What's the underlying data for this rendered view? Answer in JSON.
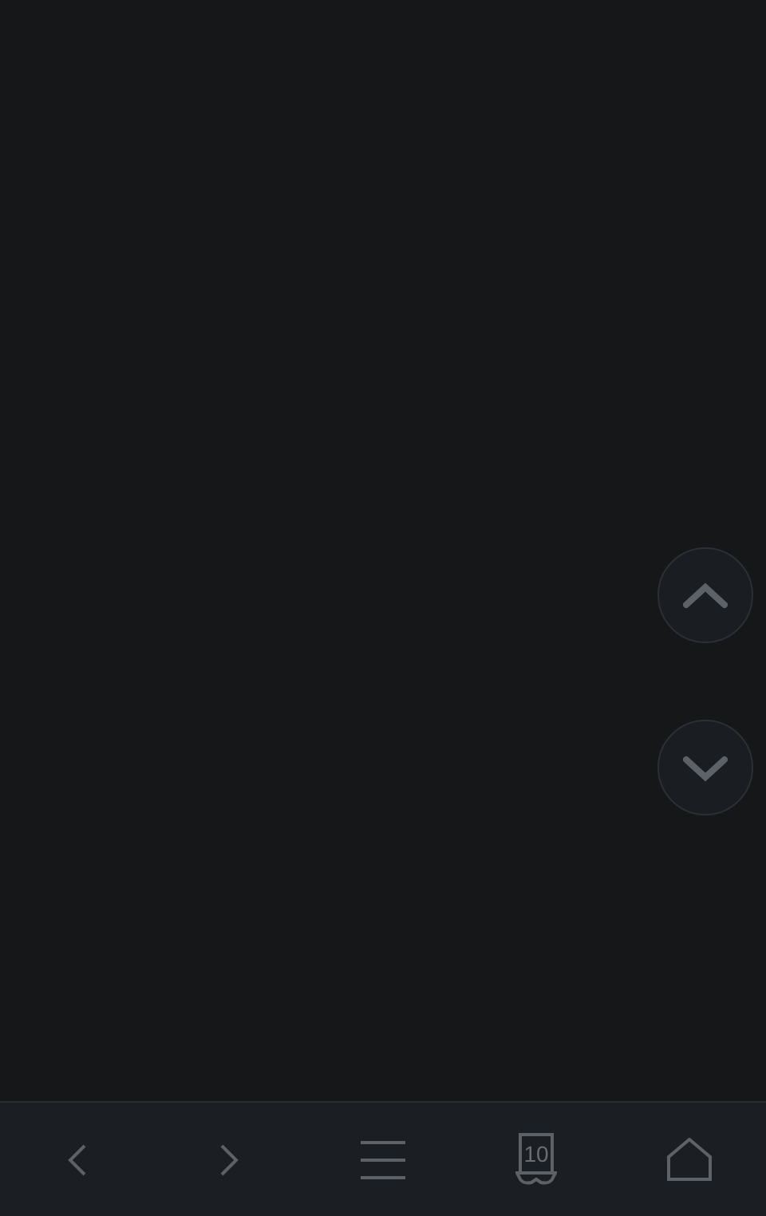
{
  "scroll_buttons": [
    {
      "kind": "up"
    },
    {
      "kind": "down"
    }
  ],
  "toolbar": [
    {
      "kind": "back"
    },
    {
      "kind": "forward"
    },
    {
      "kind": "menu"
    },
    {
      "kind": "tabs",
      "count": "10"
    },
    {
      "kind": "home"
    }
  ]
}
